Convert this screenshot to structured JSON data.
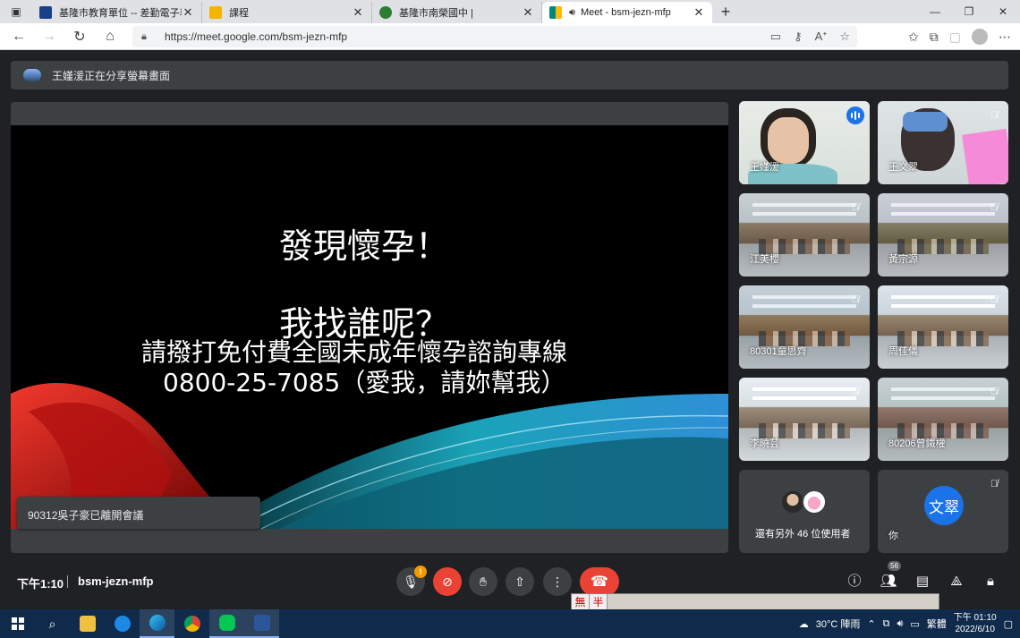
{
  "browser": {
    "tabs": [
      {
        "label": "基隆市教育單位 -- 差勤電子表單",
        "favicon_color": "#1a3f8a"
      },
      {
        "label": "課程",
        "favicon_color": "#f4b400"
      },
      {
        "label": "基隆市南榮國中 |",
        "favicon_color": "#2e7d32"
      },
      {
        "label": "Meet - bsm-jezn-mfp",
        "favicon_color": "#00897b"
      }
    ],
    "url": "https://meet.google.com/bsm-jezn-mfp"
  },
  "meet": {
    "share_banner": "王嫤湲正在分享螢幕畫面",
    "slide": {
      "line1": "發現懷孕！",
      "line2": "我找誰呢？",
      "line3": "請撥打免付費全國未成年懷孕諮詢專線",
      "line4": "0800-25-7085（愛我，請妳幫我）"
    },
    "toast": "90312吳子豪已離開會議",
    "participants": [
      {
        "name": "王嫤湲",
        "speaking": true
      },
      {
        "name": "王文翠",
        "muted": true
      },
      {
        "name": "江美櫻",
        "muted": true
      },
      {
        "name": "黃宗源",
        "muted": true
      },
      {
        "name": "80301童思齊",
        "muted": true
      },
      {
        "name": "周佳儀",
        "muted": true
      },
      {
        "name": "李曉芸",
        "muted": true
      },
      {
        "name": "80206曾鐵權",
        "muted": true
      }
    ],
    "more_users": "還有另外 46 位使用者",
    "you": {
      "label": "你",
      "initials": "文翠"
    },
    "clock": "下午1:10",
    "meeting_code": "bsm-jezn-mfp",
    "participant_count": "56",
    "warn_badge": "!"
  },
  "ime": {
    "mode1": "無",
    "mode2": "半"
  },
  "taskbar": {
    "weather": "30°C 陣雨",
    "lang": "繁體",
    "time": "下午 01:10",
    "date": "2022/6/10"
  },
  "colors": {
    "accent": "#8ab4f8",
    "danger": "#ea4335",
    "surface": "#3c4043",
    "background": "#202124"
  }
}
